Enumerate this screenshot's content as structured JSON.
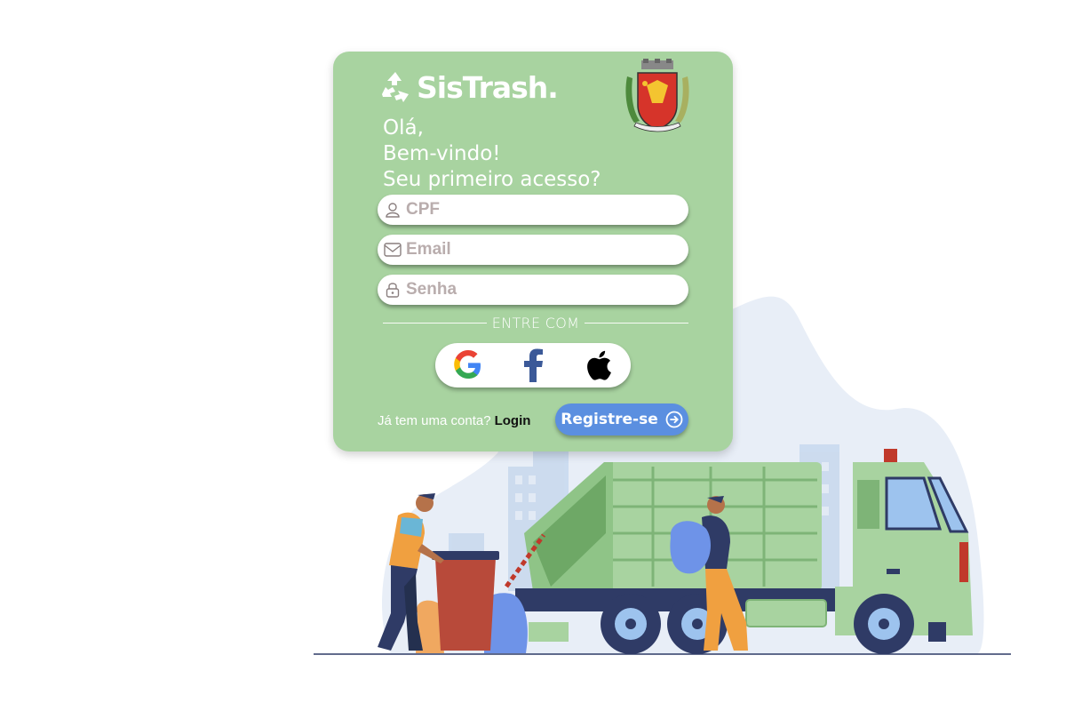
{
  "brand": {
    "name": "SisTrash."
  },
  "greeting": {
    "line1": "Olá,",
    "line2": "Bem-vindo!",
    "line3": "Seu primeiro acesso?"
  },
  "form": {
    "cpf_placeholder": "CPF",
    "email_placeholder": "Email",
    "senha_placeholder": "Senha"
  },
  "social": {
    "divider_label": "ENTRE COM",
    "providers": [
      "google",
      "facebook",
      "apple"
    ]
  },
  "footer": {
    "have_account": "Já tem uma conta?",
    "login_label": "Login",
    "register_label": "Registre-se"
  },
  "colors": {
    "card": "#a8d3a0",
    "truck": "#a8d3a0",
    "register_button": "#5b8fe0",
    "background_blob": "#e7eef7"
  },
  "icons": [
    "recycle-icon",
    "city-crest",
    "user-icon",
    "mail-icon",
    "lock-icon",
    "google-icon",
    "facebook-icon",
    "apple-icon",
    "arrow-right-circle-icon"
  ]
}
